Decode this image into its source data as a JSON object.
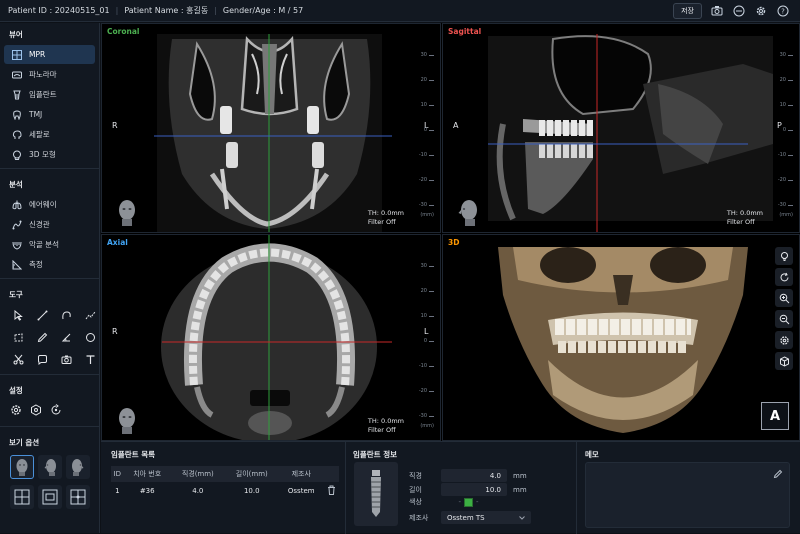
{
  "topbar": {
    "patient_id": "Patient ID : 20240515_01",
    "patient_name": "Patient Name : 홍길동",
    "gender_age": "Gender/Age : M / 57",
    "save_label": "저장",
    "icons": [
      "camera-icon",
      "circle-minus-icon",
      "gear-icon",
      "help-icon"
    ]
  },
  "sidebar": {
    "viewer_title": "뷰어",
    "viewer_items": [
      {
        "label": "MPR",
        "icon": "mpr-icon",
        "active": true
      },
      {
        "label": "파노라마",
        "icon": "panorama-icon",
        "active": false
      },
      {
        "label": "임플란트",
        "icon": "implant-icon",
        "active": false
      },
      {
        "label": "TMJ",
        "icon": "tooth-icon",
        "active": false
      },
      {
        "label": "세팔로",
        "icon": "head-profile-icon",
        "active": false
      },
      {
        "label": "3D 모형",
        "icon": "3d-model-icon",
        "active": false
      }
    ],
    "analysis_title": "분석",
    "analysis_items": [
      {
        "label": "에어웨이",
        "icon": "lungs-icon"
      },
      {
        "label": "신경관",
        "icon": "nerve-icon"
      },
      {
        "label": "악골 분석",
        "icon": "jaw-analysis-icon"
      },
      {
        "label": "측정",
        "icon": "measure-icon"
      }
    ],
    "tools_title": "도구",
    "settings_title": "설정",
    "view_options_title": "보기 옵션"
  },
  "viewports": {
    "coronal": {
      "label": "Coronal",
      "color": "#4caf50",
      "left": "R",
      "right": "L",
      "th": "TH: 0.0mm",
      "filter": "Filter Off"
    },
    "sagittal": {
      "label": "Sagittal",
      "color": "#ef5350",
      "left": "A",
      "right": "P",
      "th": "TH: 0.0mm",
      "filter": "Filter Off"
    },
    "axial": {
      "label": "Axial",
      "color": "#42a5f5",
      "left": "R",
      "right": "L",
      "th": "TH: 0.0mm",
      "filter": "Filter Off"
    },
    "three_d": {
      "label": "3D",
      "color": "#ff9800",
      "orientation": "A"
    }
  },
  "ruler": {
    "ticks": [
      "30",
      "20",
      "10",
      "0",
      "-10",
      "-20",
      "-30"
    ],
    "unit": "(mm)"
  },
  "implant_list": {
    "title": "임플란트 목록",
    "headers": [
      "ID",
      "치아 번호",
      "직경(mm)",
      "길이(mm)",
      "제조사"
    ],
    "rows": [
      {
        "id": "1",
        "tooth": "#36",
        "diameter": "4.0",
        "length": "10.0",
        "maker": "Osstem"
      }
    ]
  },
  "implant_info": {
    "title": "임플란트 정보",
    "diameter_label": "직경",
    "diameter_value": "4.0",
    "diameter_unit": "mm",
    "length_label": "길이",
    "length_value": "10.0",
    "length_unit": "mm",
    "color_label": "색상",
    "color_value": "#3cb043",
    "maker_label": "제조사",
    "maker_value": "Osstem TS"
  },
  "memo": {
    "title": "메모"
  }
}
